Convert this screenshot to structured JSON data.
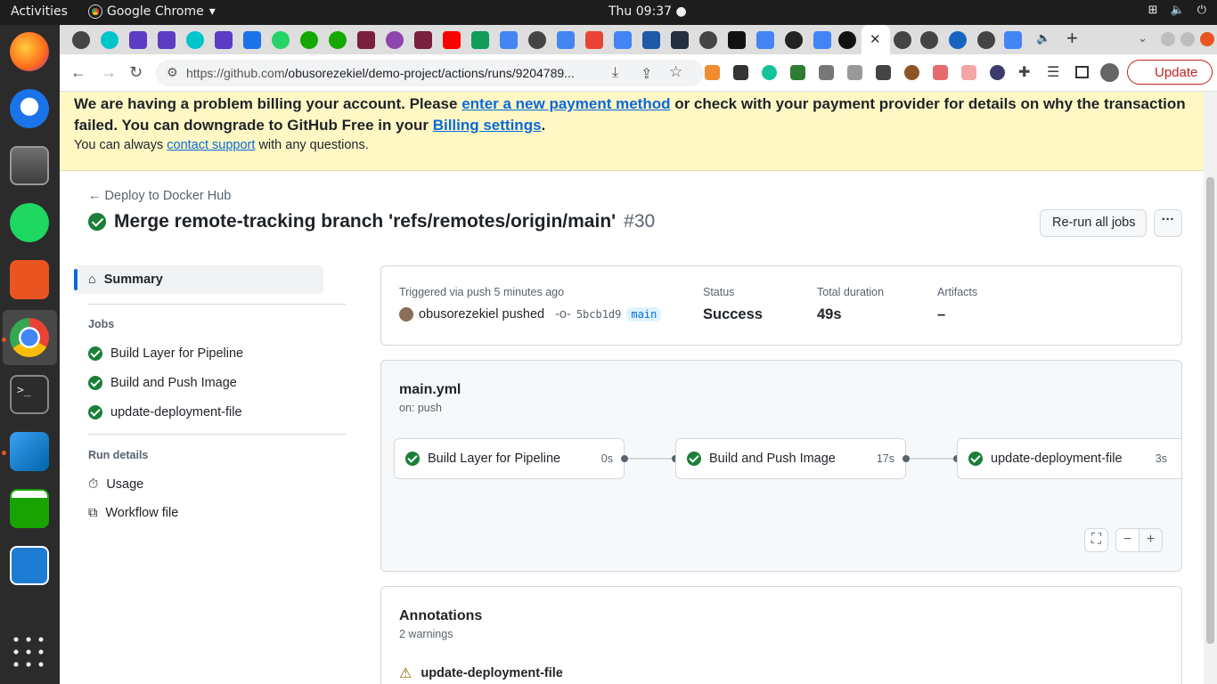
{
  "os": {
    "activities": "Activities",
    "app_name": "Google Chrome",
    "clock": "Thu 09:37"
  },
  "browser": {
    "url_host": "https://github.com",
    "url_path": "/obusorezekiel/demo-project/actions/runs/9204789...",
    "update_label": "Update"
  },
  "banner": {
    "text1": "We are having a problem billing your account. Please ",
    "link1": "enter a new payment method",
    "text2": " or check with your payment provider for details on why the transaction failed. You can downgrade to GitHub Free in your ",
    "link2": "Billing settings",
    "text3": ".",
    "text4": "You can always ",
    "link3": "contact support",
    "text5": " with any questions."
  },
  "header": {
    "back_label": "Deploy to Docker Hub",
    "title": "Merge remote-tracking branch 'refs/remotes/origin/main'",
    "run_number": "#30",
    "rerun_label": "Re-run all jobs",
    "more_label": "···"
  },
  "sidebar": {
    "summary_label": "Summary",
    "jobs_heading": "Jobs",
    "jobs": [
      "Build Layer for Pipeline",
      "Build and Push Image",
      "update-deployment-file"
    ],
    "run_details_heading": "Run details",
    "usage_label": "Usage",
    "workflow_label": "Workflow file"
  },
  "summary": {
    "triggered_text": "Triggered via push 5 minutes ago",
    "actor_text": "obusorezekiel pushed",
    "commit_sha": "5bcb1d9",
    "branch": "main",
    "status_label": "Status",
    "status_value": "Success",
    "duration_label": "Total duration",
    "duration_value": "49s",
    "artifacts_label": "Artifacts",
    "artifacts_value": "–"
  },
  "workflow": {
    "file_name": "main.yml",
    "trigger": "on: push",
    "jobs": [
      {
        "name": "Build Layer for Pipeline",
        "duration": "0s"
      },
      {
        "name": "Build and Push Image",
        "duration": "17s"
      },
      {
        "name": "update-deployment-file",
        "duration": "3s"
      }
    ]
  },
  "annotations": {
    "title": "Annotations",
    "count_text": "2 warnings",
    "first_job": "update-deployment-file"
  },
  "colors": {
    "success": "#1a7f37",
    "link": "#0969da",
    "banner_bg": "#fff8c5",
    "warning": "#9a6700"
  }
}
